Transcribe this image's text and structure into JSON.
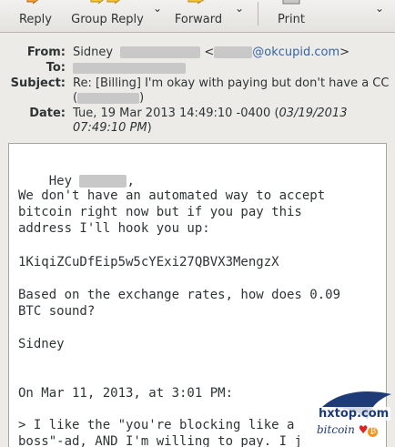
{
  "toolbar": {
    "reply": "Reply",
    "group_reply": "Group Reply",
    "forward": "Forward",
    "print": "Print"
  },
  "header": {
    "from_label": "From:",
    "from_name": "Sidney",
    "from_email_domain": "@okcupid.com",
    "from_open": "<",
    "from_close": ">",
    "to_label": "To:",
    "subject_label": "Subject:",
    "subject_line1": "Re: [Billing] I'm okay with paying but don't have a CC",
    "subject_line2_open": "(",
    "subject_line2_close": ")",
    "date_label": "Date:",
    "date_main": "Tue, 19 Mar 2013 14:49:10 -0400 (",
    "date_local_1": "03/19/2013",
    "date_local_2": "07:49:10 PM",
    "date_close": ")"
  },
  "message": {
    "greeting_hey": "Hey",
    "greeting_comma": ",",
    "p1_l1": "We don't have an automated way to accept",
    "p1_l2": "bitcoin right now but if you pay this",
    "p1_l3": "address I'll hook you up:",
    "address": "1KiqiZCuDfEip5w5cYExi27QBVX3MengzX",
    "p2_l1": "Based on the exchange rates, how does 0.09",
    "p2_l2": "BTC sound?",
    "signature": "Sidney",
    "quote_header": "On Mar 11, 2013, at 3:01 PM:",
    "quote_l1": "> I like the \"you're blocking like a",
    "quote_l2": "boss\"-ad, AND I'm willing to pay. I j"
  },
  "watermark": {
    "site": "hxtop.com",
    "tagline": "bitcoin"
  },
  "colors": {
    "link": "#3465a4",
    "text": "#2e3436",
    "toolbar_bg": "#e9e8e5",
    "body_bg": "#ffffff"
  }
}
